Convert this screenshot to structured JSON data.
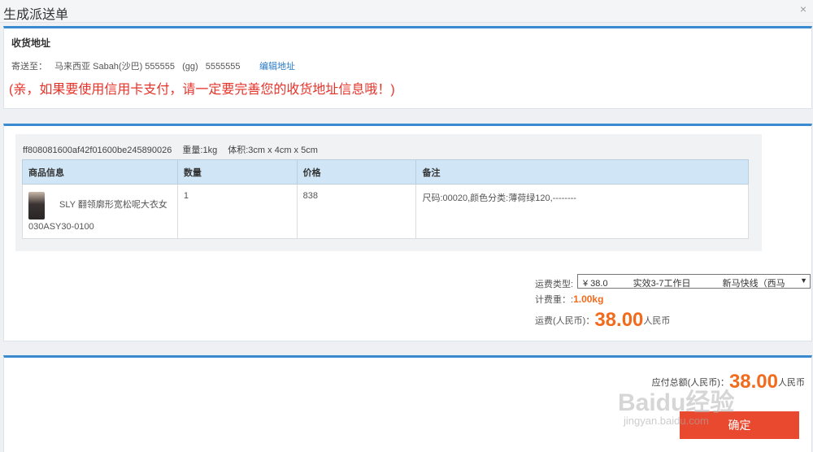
{
  "dialog": {
    "title": "生成派送单",
    "close_glyph": "×"
  },
  "address": {
    "section_title": "收货地址",
    "ship_to_label": "寄送至：",
    "location": "马来西亚 Sabah(沙巴) 555555",
    "recipient": "(gg)",
    "phone": "5555555",
    "edit_label": "编辑地址",
    "warning": "(亲，如果要使用信用卡支付，请一定要完善您的收货地址信息哦！)"
  },
  "package": {
    "id": "ff808081600af42f01600be245890026",
    "weight": "重量:1kg",
    "volume": "体积:3cm x 4cm x 5cm",
    "columns": [
      "商品信息",
      "数量",
      "价格",
      "备注"
    ],
    "item": {
      "name": "SLY 翻领廓形宽松呢大衣女",
      "code": "030ASY30-0100",
      "quantity": "1",
      "price": "838",
      "note": "尺码:00020,颜色分类:薄荷绿120,--------"
    }
  },
  "shipping": {
    "type_label": "运费类型:",
    "selected_price": "¥ 38.0",
    "selected_time": "实效3-7工作日",
    "selected_carrier": "新马快线（西马",
    "weight_label": "计费重：:",
    "weight_value": "1.00kg",
    "fee_label": "运费(人民币)：",
    "fee_value": "38.00",
    "fee_unit": "人民币"
  },
  "total": {
    "label": "应付总额(人民币)：",
    "value": "38.00",
    "unit": "人民币",
    "confirm_label": "确定"
  },
  "watermark": {
    "brand": "Baidu经验",
    "url": "jingyan.baidu.com"
  },
  "colors": {
    "accent_blue": "#3a8ad0",
    "price_orange": "#f26b1d",
    "warning_red": "#e6332a",
    "button_red": "#e8492f"
  }
}
